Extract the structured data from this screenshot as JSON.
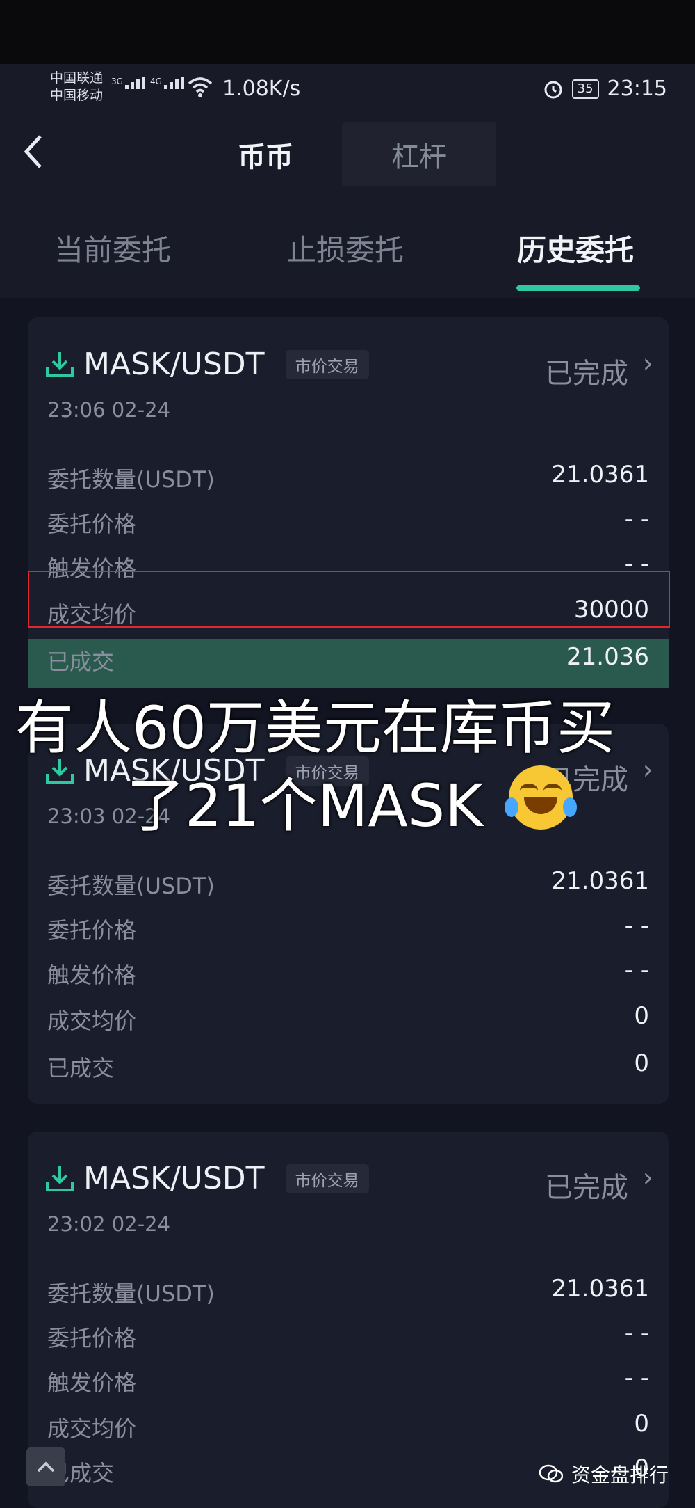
{
  "status_bar": {
    "carrier1": "中国联通",
    "carrier2": "中国移动",
    "net1": "3G",
    "net2": "4G",
    "speed": "1.08K/s",
    "battery": "35",
    "time": "23:15"
  },
  "header": {
    "back_icon": "chevron-left-icon",
    "segments": [
      "币币",
      "杠杆"
    ],
    "active_segment": "币币"
  },
  "tabs": {
    "items": [
      "当前委托",
      "止损委托",
      "历史委托"
    ],
    "active": "历史委托"
  },
  "orders": [
    {
      "pair": "MASK/USDT",
      "type": "市价交易",
      "status": "已完成",
      "time": "23:06 02-24",
      "rows": [
        {
          "label": "委托数量(USDT)",
          "value": "21.0361"
        },
        {
          "label": "委托价格",
          "value": "- -"
        },
        {
          "label": "触发价格",
          "value": "- -"
        },
        {
          "label": "成交均价",
          "value": "30000"
        },
        {
          "label": "已成交",
          "value": "21.036"
        }
      ],
      "fill_fraction": 1.0
    },
    {
      "pair": "MASK/USDT",
      "type": "市价交易",
      "status": "已完成",
      "time": "23:03 02-24",
      "rows": [
        {
          "label": "委托数量(USDT)",
          "value": "21.0361"
        },
        {
          "label": "委托价格",
          "value": "- -"
        },
        {
          "label": "触发价格",
          "value": "- -"
        },
        {
          "label": "成交均价",
          "value": "0"
        },
        {
          "label": "已成交",
          "value": "0"
        }
      ]
    },
    {
      "pair": "MASK/USDT",
      "type": "市价交易",
      "status": "已完成",
      "time": "23:02 02-24",
      "rows": [
        {
          "label": "委托数量(USDT)",
          "value": "21.0361"
        },
        {
          "label": "委托价格",
          "value": "- -"
        },
        {
          "label": "触发价格",
          "value": "- -"
        },
        {
          "label": "成交均价",
          "value": "0"
        },
        {
          "label": "已成交",
          "value": "0"
        }
      ]
    }
  ],
  "caption": {
    "line1": "有人60万美元在库币买",
    "line2": "了21个MASK"
  },
  "watermark": {
    "text": "资金盘排行"
  },
  "colors": {
    "accent": "#30c8a0",
    "highlight_border": "#e2262b",
    "background": "#121421"
  }
}
